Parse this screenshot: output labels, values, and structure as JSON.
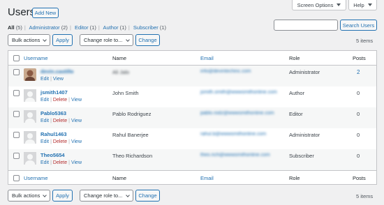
{
  "page": {
    "title": "Users",
    "add_new": "Add New"
  },
  "top_tabs": {
    "screen_options": "Screen Options",
    "help": "Help"
  },
  "filters": [
    {
      "label": "All",
      "count": "(5)",
      "current": true
    },
    {
      "label": "Administrator",
      "count": "(2)"
    },
    {
      "label": "Editor",
      "count": "(1)"
    },
    {
      "label": "Author",
      "count": "(1)"
    },
    {
      "label": "Subscriber",
      "count": "(1)"
    }
  ],
  "search": {
    "button": "Search Users",
    "value": ""
  },
  "bulk": {
    "top_label": "Bulk actions",
    "apply": "Apply",
    "change_role": "Change role to...",
    "change": "Change"
  },
  "items_count": "5 items",
  "columns": {
    "username": "Username",
    "name": "Name",
    "email": "Email",
    "role": "Role",
    "posts": "Posts"
  },
  "actions": {
    "edit": "Edit",
    "delete": "Delete",
    "view": "View"
  },
  "rows": [
    {
      "username": "devin.castillo",
      "name": "Ali Jalo",
      "email": "info@devintechinc.com",
      "role": "Administrator",
      "posts": "2",
      "blurred": true,
      "has_delete": false
    },
    {
      "username": "jsmith1407",
      "name": "John Smith",
      "email": "jsmith.smith@wwwsmithonline.com",
      "role": "Author",
      "posts": "0",
      "blurred": false,
      "has_delete": true
    },
    {
      "username": "Pablo5363",
      "name": "Pablo Rodriguez",
      "email": "pablo.rodz@wwwsmithonline.com",
      "role": "Editor",
      "posts": "0",
      "blurred": false,
      "has_delete": true
    },
    {
      "username": "Rahul1463",
      "name": "Rahul Banerjee",
      "email": "rahul.b@wwwsmithonline.com",
      "role": "Administrator",
      "posts": "0",
      "blurred": false,
      "has_delete": true
    },
    {
      "username": "Theo5654",
      "name": "Theo Richardson",
      "email": "theo.rich@wwwsmithonline.com",
      "role": "Subscriber",
      "posts": "0",
      "blurred": false,
      "has_delete": true
    }
  ],
  "colors": {
    "link": "#2271b1",
    "delete": "#b32d2e",
    "border": "#c3c4c7",
    "background": "#f0f0f1"
  }
}
